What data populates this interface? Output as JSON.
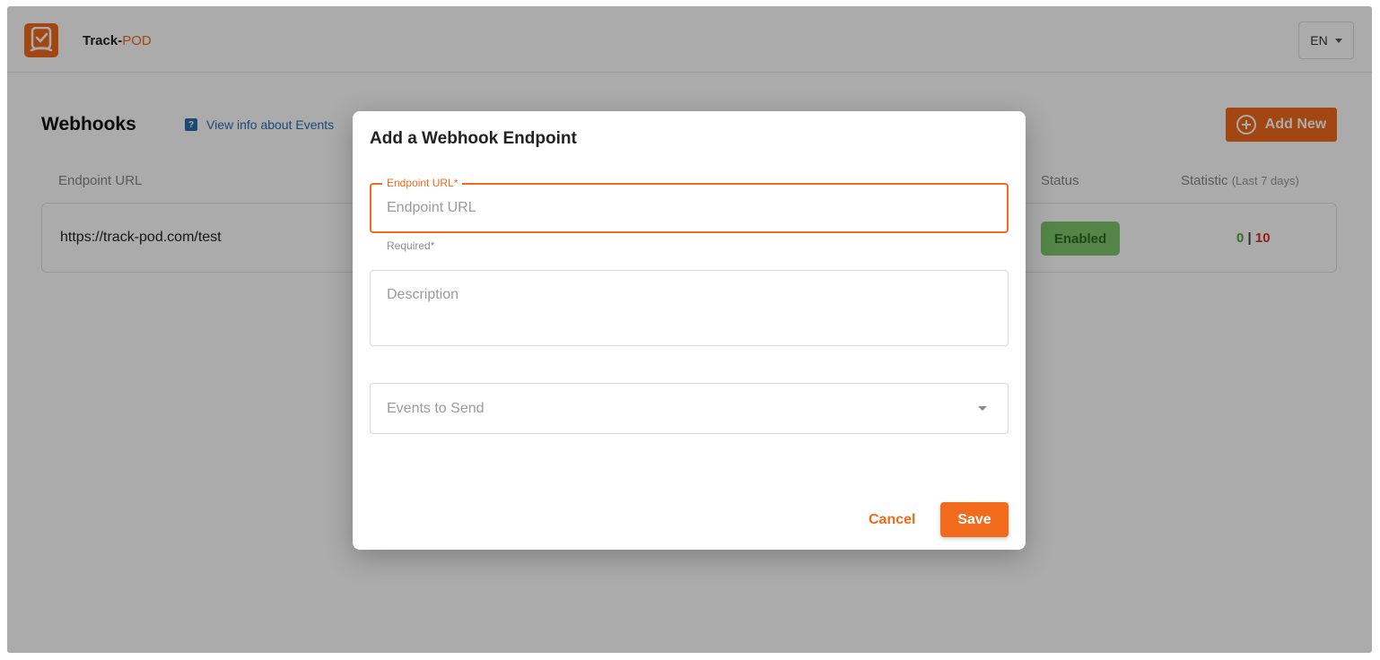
{
  "app": {
    "brand_prefix": "Track-",
    "brand_suffix": "POD",
    "language": "EN"
  },
  "page": {
    "title": "Webhooks",
    "info_link": "View info about Events",
    "add_new_label": "Add New",
    "columns": {
      "endpoint_url": "Endpoint URL",
      "status": "Status",
      "statistic": "Statistic",
      "statistic_period": "(Last 7 days)"
    },
    "rows": [
      {
        "url": "https://track-pod.com/test",
        "status": "Enabled",
        "success_count": "0",
        "separator": "|",
        "error_count": "10"
      }
    ]
  },
  "modal": {
    "title": "Add a Webhook Endpoint",
    "endpoint_url": {
      "label": "Endpoint URL*",
      "placeholder": "Endpoint URL",
      "value": "",
      "helper": "Required*"
    },
    "description": {
      "placeholder": "Description",
      "value": ""
    },
    "events": {
      "placeholder": "Events to Send"
    },
    "cancel_label": "Cancel",
    "save_label": "Save"
  },
  "colors": {
    "accent": "#f26a1b",
    "enabled_badge": "#7ec56a",
    "success": "#55a53e",
    "error": "#d93025",
    "link": "#2a6fb0"
  }
}
